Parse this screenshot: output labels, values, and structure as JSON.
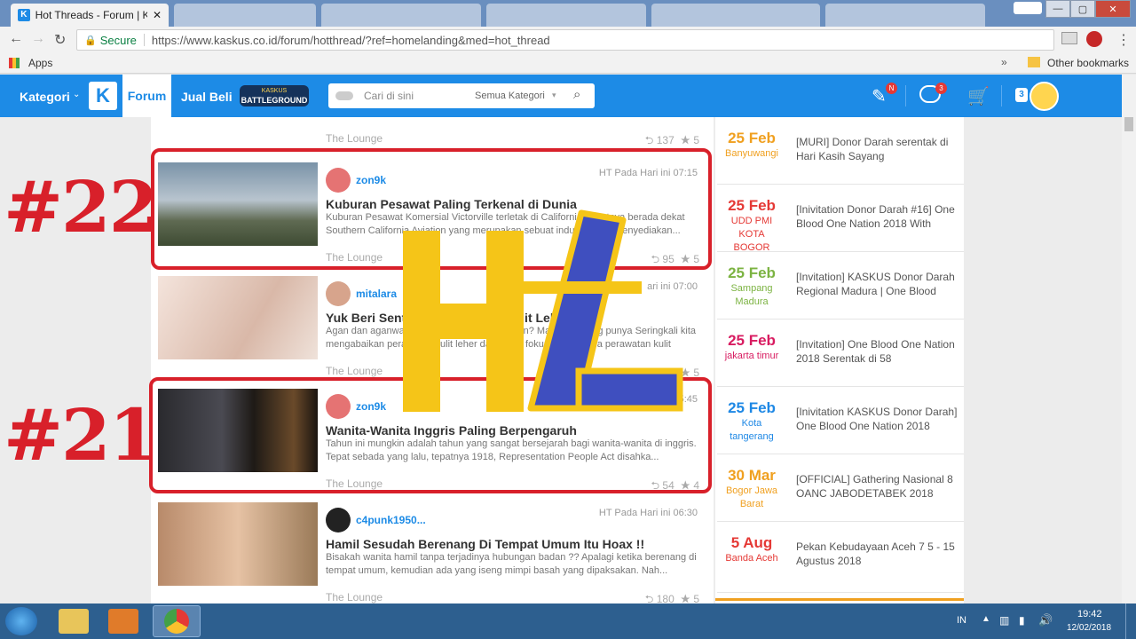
{
  "browser": {
    "active_tab_title": "Hot Threads - Forum | K...",
    "url_secure_label": "Secure",
    "url": "https://www.kaskus.co.id/forum/hotthread/?ref=homelanding&med=hot_thread",
    "bookmarks_apps": "Apps",
    "bookmarks_other": "Other bookmarks"
  },
  "header": {
    "kategori": "Kategori",
    "forum": "Forum",
    "jual_beli": "Jual Beli",
    "battleground_top": "KASKUS",
    "battleground_bottom": "BATTLEGROUND",
    "search_placeholder": "Cari di sini",
    "search_category": "Semua Kategori",
    "notif_badge": "N",
    "chat_badge": "3",
    "user_badge": "3"
  },
  "threads": [
    {
      "user": "",
      "time": "",
      "title": "",
      "desc": "",
      "category": "The Lounge",
      "replies": "137",
      "rating": "5"
    },
    {
      "user": "zon9k",
      "time": "HT Pada Hari ini 07:15",
      "title": "Kuburan Pesawat Paling Terkenal di Dunia",
      "desc": "Kuburan Pesawat Komersial Victorville terletak di California, tepatnya berada dekat Southern California Aviation yang merupakan sebuat industri yang menyediakan...",
      "category": "The Lounge",
      "replies": "95",
      "rating": "5"
    },
    {
      "user": "mitalara",
      "time": "ari ini 07:00",
      "title": "Yuk Beri Sentuhan Perawatan Kulit Leher",
      "desc": "Agan dan aganwati pasti sudah tahu dong ‘kan? Masing-masing punya Seringkali kita mengabaikan perawatan kulit leher dan justru fokus hanya pada perawatan kulit waja...",
      "category": "The Lounge",
      "replies": "56",
      "rating": "5"
    },
    {
      "user": "zon9k",
      "time": "5:45",
      "title": "Wanita-Wanita Inggris Paling Berpengaruh",
      "desc": "Tahun ini mungkin adalah tahun yang sangat bersejarah bagi wanita-wanita di inggris. Tepat sebada yang lalu, tepatnya 1918, Representation People Act disahka...",
      "category": "The Lounge",
      "replies": "54",
      "rating": "4"
    },
    {
      "user": "c4punk1950...",
      "time": "HT Pada Hari ini 06:30",
      "title": "Hamil Sesudah Berenang Di Tempat Umum Itu Hoax !!",
      "desc": "Bisakah wanita hamil tanpa terjadinya hubungan badan ?? Apalagi ketika berenang di tempat umum, kemudian ada yang iseng mimpi basah yang dipaksakan. Nah...",
      "category": "The Lounge",
      "replies": "180",
      "rating": "5"
    }
  ],
  "overlay": {
    "label_22": "#22",
    "label_21": "#21"
  },
  "events": [
    {
      "date": "25 Feb",
      "location": "Banyuwangi",
      "title": "[MURI] Donor Darah serentak di Hari Kasih Sayang",
      "color": "#f0a020"
    },
    {
      "date": "25 Feb",
      "location": "UDD PMI KOTA BOGOR",
      "title": "[Inivitation Donor Darah #16] One Blood One Nation 2018 With",
      "color": "#e53935"
    },
    {
      "date": "25 Feb",
      "location": "Sampang Madura",
      "title": "[Invitation] KASKUS Donor Darah Regional Madura | One Blood",
      "color": "#7cb342"
    },
    {
      "date": "25 Feb",
      "location": "jakarta timur",
      "title": "[Invitation] One Blood One Nation 2018 Serentak di 58",
      "color": "#d81b60"
    },
    {
      "date": "25 Feb",
      "location": "Kota tangerang",
      "title": "[Inivitation KASKUS Donor Darah] One Blood One Nation 2018",
      "color": "#1e88e5"
    },
    {
      "date": "30 Mar",
      "location": "Bogor Jawa Barat",
      "title": "[OFFICIAL] Gathering Nasional 8 OANC JABODETABEK 2018",
      "color": "#f0a020"
    },
    {
      "date": "5 Aug",
      "location": "Banda Aceh",
      "title": "Pekan Kebudayaan Aceh 7 5 - 15 Agustus 2018",
      "color": "#e53935"
    }
  ],
  "taskbar": {
    "lang": "IN",
    "time": "19:42",
    "date": "12/02/2018"
  }
}
